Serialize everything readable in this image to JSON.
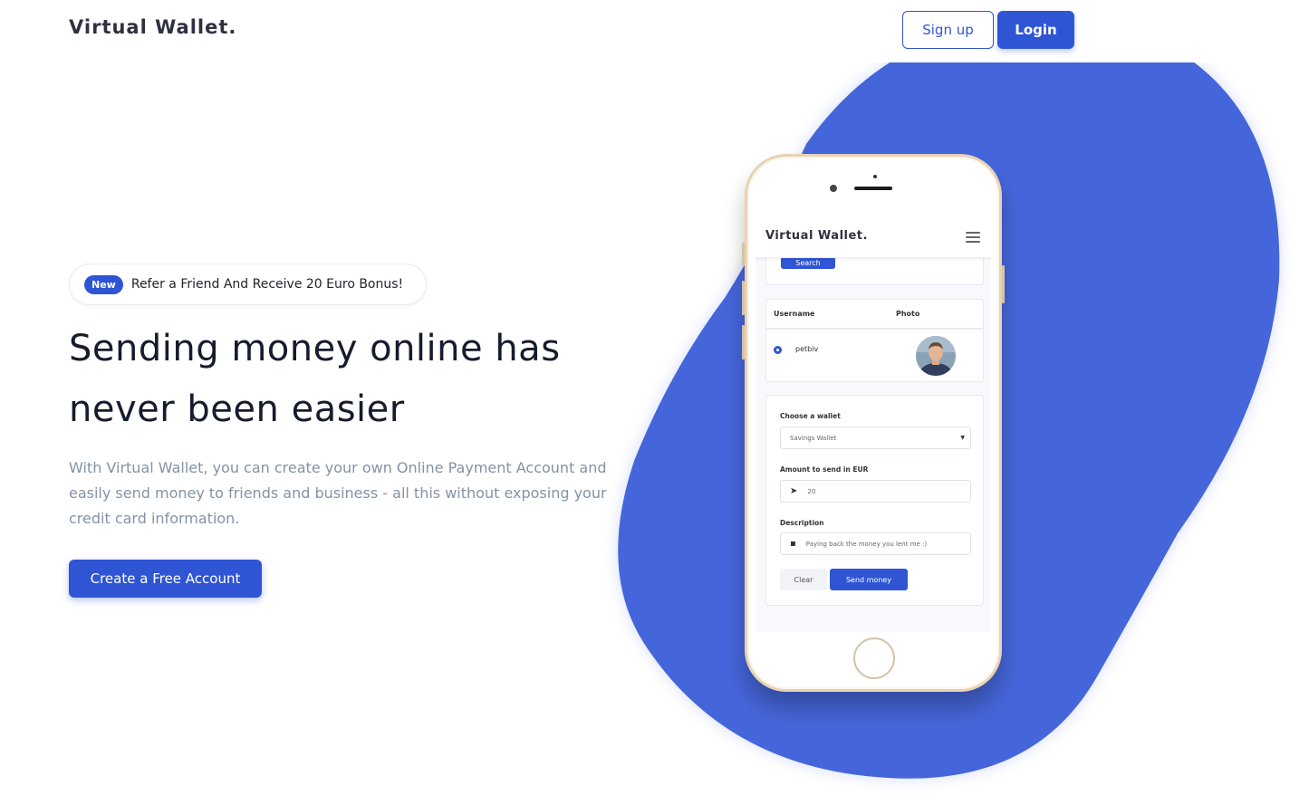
{
  "header": {
    "brand": "Virtual Wallet.",
    "signup_label": "Sign up",
    "login_label": "Login"
  },
  "hero": {
    "promo_badge": "New",
    "promo_text": "Refer a Friend And Receive 20 Euro Bonus!",
    "headline": "Sending money online has never been easier",
    "description": "With Virtual Wallet, you can create your own Online Payment Account and easily send money to friends and business - all this without exposing your credit card information.",
    "cta_label": "Create a Free Account"
  },
  "phone_app": {
    "brand": "Virtual Wallet.",
    "search_button": "Search",
    "table": {
      "col_username": "Username",
      "col_photo": "Photo",
      "row_username": "petbiv"
    },
    "form": {
      "wallet_label": "Choose a wallet",
      "wallet_value": "Savings Wallet",
      "amount_label": "Amount to send in EUR",
      "amount_value": "20",
      "description_label": "Description",
      "description_value": "Paying back the money you lent me :)",
      "clear_label": "Clear",
      "send_label": "Send money"
    }
  },
  "colors": {
    "primary": "#2f55d4",
    "blob": "#4566da",
    "muted_text": "#8492a6",
    "dark_text": "#161c2d"
  }
}
